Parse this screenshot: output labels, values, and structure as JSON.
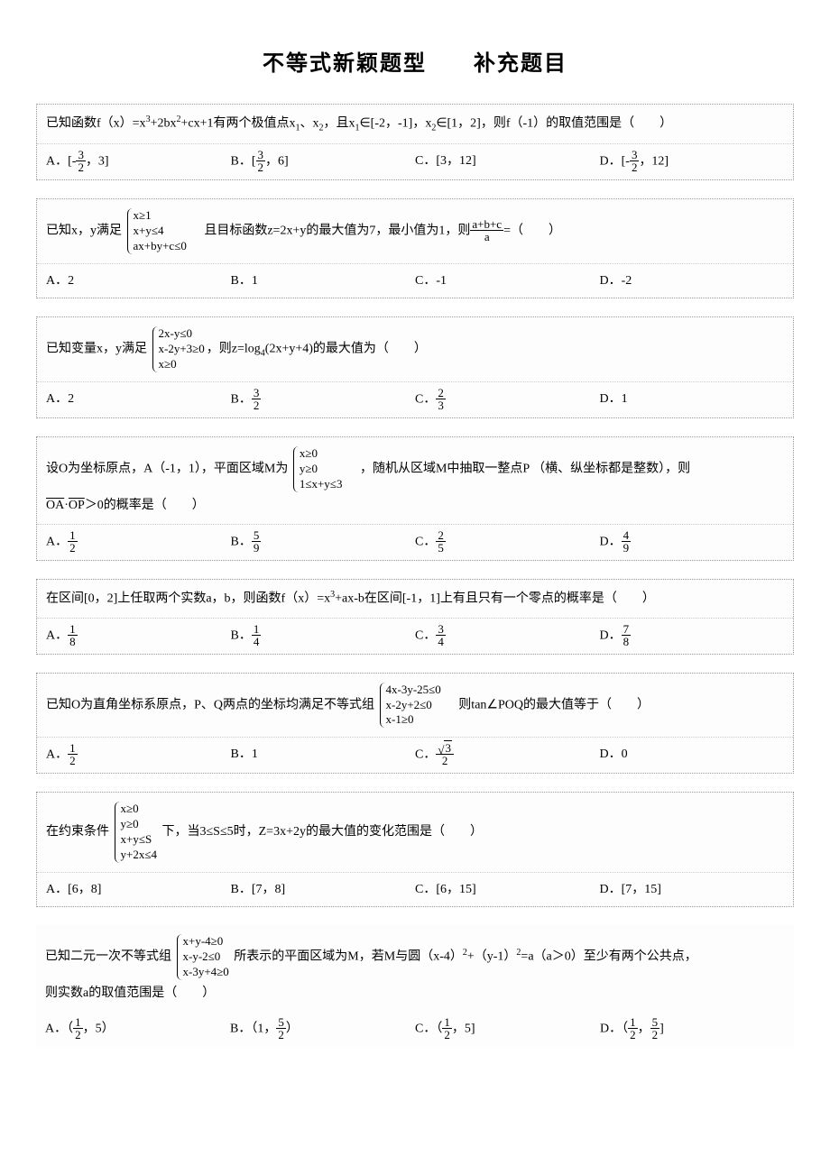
{
  "title": "不等式新颖题型　　补充题目",
  "questions": [
    {
      "text_pre": "已知函数f（x）=x",
      "text_mid1": "+2bx",
      "text_mid2": "+cx+1有两个极值点x",
      "text_mid3": "、x",
      "text_mid4": "，且x",
      "text_mid5": "∈[-2，-1]，x",
      "text_mid6": "∈[1，2]，则f（-1）的取值范围是（　　）",
      "A_label": "A．[-",
      "A_num": "3",
      "A_den": "2",
      "A_after": "，3]",
      "B_label": "B．[",
      "B_num": "3",
      "B_den": "2",
      "B_after": "，6]",
      "C": "C．[3，12]",
      "D_label": "D．[-",
      "D_num": "3",
      "D_den": "2",
      "D_after": "，12]"
    },
    {
      "text_pre": "已知x，y满足",
      "c1": "x≥1",
      "c2": "x+y≤4",
      "c3": "ax+by+c≤0",
      "text_mid": "　且目标函数z=2x+y的最大值为7，最小值为1，则",
      "frac_num": "a+b+c",
      "frac_den": "a",
      "text_post": "=（　　）",
      "A": "A．2",
      "B": "B．1",
      "C": "C．-1",
      "D": "D．-2"
    },
    {
      "text_pre": "已知变量x，y满足",
      "c1": "2x-y≤0",
      "c2": "x-2y+3≥0",
      "c3": "x≥0",
      "text_mid": "，则z=log",
      "text_post": "(2x+y+4)的最大值为（　　）",
      "A": "A．2",
      "B_label": "B．",
      "B_num": "3",
      "B_den": "2",
      "C_label": "C．",
      "C_num": "2",
      "C_den": "3",
      "D": "D．1"
    },
    {
      "text_pre": "设O为坐标原点，A（-1，1），平面区域M为",
      "c1": "x≥0",
      "c2": "y≥0",
      "c3": "1≤x+y≤3",
      "text_mid": "　，随机从区域M中抽取一整点P （横、纵坐标都是整数），则",
      "text_line2_pre": "",
      "vec1": "OA",
      "dot": "·",
      "vec2": "OP",
      "text_line2_post": "＞0的概率是（　　）",
      "A_label": "A．",
      "A_num": "1",
      "A_den": "2",
      "B_label": "B．",
      "B_num": "5",
      "B_den": "9",
      "C_label": "C．",
      "C_num": "2",
      "C_den": "5",
      "D_label": "D．",
      "D_num": "4",
      "D_den": "9"
    },
    {
      "text": "在区间[0，2]上任取两个实数a，b，则函数f（x）=x",
      "text_post": "+ax-b在区间[-1，1]上有且只有一个零点的概率是（　　）",
      "A_label": "A．",
      "A_num": "1",
      "A_den": "8",
      "B_label": "B．",
      "B_num": "1",
      "B_den": "4",
      "C_label": "C．",
      "C_num": "3",
      "C_den": "4",
      "D_label": "D．",
      "D_num": "7",
      "D_den": "8"
    },
    {
      "text_pre": "已知O为直角坐标系原点，P、Q两点的坐标均满足不等式组",
      "c1": "4x-3y-25≤0",
      "c2": "x-2y+2≤0",
      "c3": "x-1≥0",
      "text_post": "　则tan∠POQ的最大值等于（　　）",
      "A_label": "A．",
      "A_num": "1",
      "A_den": "2",
      "B": "B．1",
      "C_label": "C．",
      "C_sqrt": "3",
      "C_den": "2",
      "D": "D．0"
    },
    {
      "text_pre": "在约束条件",
      "c1": "x≥0",
      "c2": "y≥0",
      "c3": "x+y≤S",
      "c4": "y+2x≤4",
      "text_post": " 下，当3≤S≤5时，Z=3x+2y的最大值的变化范围是（　　）",
      "A": "A．[6，8]",
      "B": "B．[7，8]",
      "C": "C．[6，15]",
      "D": "D．[7，15]"
    },
    {
      "text_pre": "已知二元一次不等式组",
      "c1": "x+y-4≥0",
      "c2": "x-y-2≤0",
      "c3": "x-3y+4≥0",
      "text_mid1": " 所表示的平面区域为M，若M与圆（x-4）",
      "text_mid2": "+（y-1）",
      "text_mid3": "=a（a＞0）至少有两个公共点，",
      "text_line2": "则实数a的取值范围是（　　）",
      "A_label": "A．（",
      "A_num": "1",
      "A_den": "2",
      "A_after": "，5）",
      "B_label": "B．（1，",
      "B_num": "5",
      "B_den": "2",
      "B_after": "）",
      "C_label": "C．（",
      "C_num": "1",
      "C_den": "2",
      "C_after": "，5]",
      "D_label": "D．（",
      "D_num1": "1",
      "D_den1": "2",
      "D_mid": "，",
      "D_num2": "5",
      "D_den2": "2",
      "D_after": "]"
    }
  ]
}
